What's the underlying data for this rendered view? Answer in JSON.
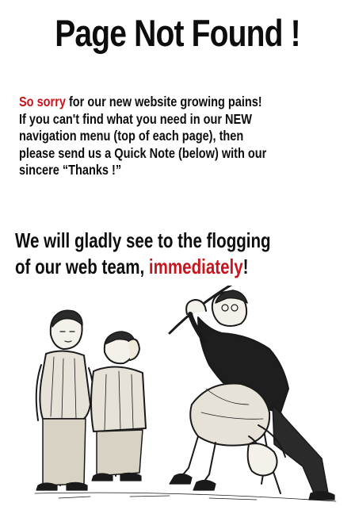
{
  "page": {
    "title": "Page Not Found !"
  },
  "apology": {
    "lead_red": "So sorry",
    "line1_rest": " for our new website growing pains!",
    "line2": "If you can't find what you need in our NEW",
    "line3": "navigation menu (top of each page), then",
    "line4": "please send us a Quick Note (below) with our",
    "line5": "sincere “Thanks !”"
  },
  "promise": {
    "line1": "We will gladly see to the flogging",
    "line2_start": "of our web team, ",
    "line2_red": "immediately",
    "line2_end": "!"
  },
  "colors": {
    "accent_red": "#c8141c",
    "text": "#0d0d0d",
    "background": "#ffffff"
  }
}
